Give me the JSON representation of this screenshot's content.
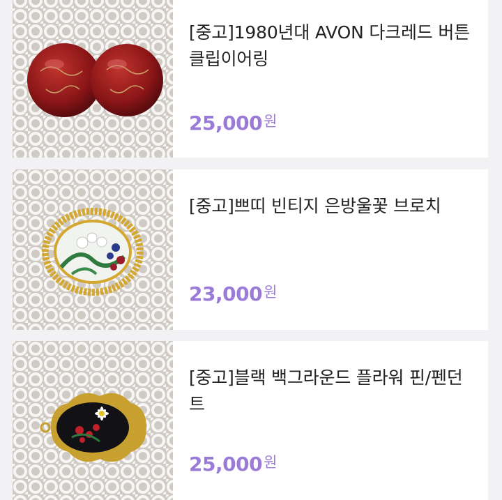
{
  "products": [
    {
      "title": "[중고]1980년대 AVON 다크레드 버튼 클립이어링",
      "price": "25,000",
      "currency": "원",
      "image": "red-clip-earrings-photo"
    },
    {
      "title": "[중고]쁘띠 빈티지 은방울꽃 브로치",
      "price": "23,000",
      "currency": "원",
      "image": "lily-of-the-valley-brooch-photo"
    },
    {
      "title": "[중고]블랙 백그라운드 플라워 핀/펜던트",
      "price": "25,000",
      "currency": "원",
      "image": "black-flower-pin-pendant-photo"
    }
  ],
  "colors": {
    "background": "#f2f2f5",
    "card": "#ffffff",
    "price": "#9b7bd8",
    "title": "#222222"
  }
}
